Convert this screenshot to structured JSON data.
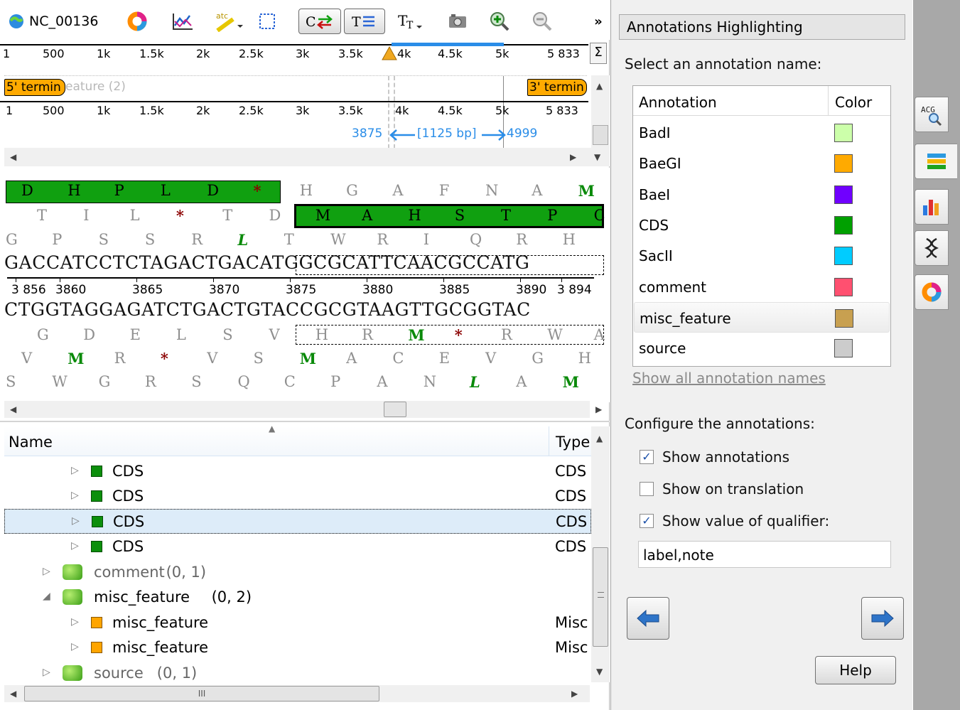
{
  "toolbar": {
    "sequence_name": "NC_00136",
    "overflow": "»"
  },
  "overview_ruler": {
    "labels": [
      "1",
      "500",
      "1k",
      "1.5k",
      "2k",
      "2.5k",
      "3k",
      "3.5k",
      "4k",
      "4.5k",
      "5k",
      "5 833"
    ],
    "sigma": "Σ"
  },
  "feature_track": {
    "left_arrow": "5' termin",
    "middle_text": "eature (2)",
    "right_arrow": "3' termin"
  },
  "detail_ruler": {
    "labels": [
      "1",
      "500",
      "1k",
      "1.5k",
      "2k",
      "2.5k",
      "3k",
      "3.5k",
      "4k",
      "4.5k",
      "5k",
      "5 833"
    ],
    "selection_start": "3875",
    "selection_len": "[1125 bp]",
    "selection_end": "4999"
  },
  "sequence": {
    "frame1": [
      "D",
      "H",
      "P",
      "L",
      "D",
      "*",
      "H",
      "G",
      "A",
      "F",
      "N",
      "A",
      "M"
    ],
    "frame2": [
      "T",
      "I",
      "L",
      "*",
      "T",
      "D",
      "M",
      "A",
      "H",
      "S",
      "T",
      "P",
      "C"
    ],
    "frame3": [
      "G",
      "P",
      "S",
      "S",
      "R",
      "L",
      "T",
      "W",
      "R",
      "I",
      "Q",
      "R",
      "H"
    ],
    "dna_top": "GACCATCCTCTAGACTGACATGGCGCATTCAACGCCATG",
    "positions": [
      "3 856",
      "3860",
      "3865",
      "3870",
      "3875",
      "3880",
      "3885",
      "3890",
      "3 894"
    ],
    "dna_bottom": "CTGGTAGGAGATCTGACTGTACCGCGTAAGTTGCGGTAC",
    "rframe1": [
      "G",
      "D",
      "E",
      "L",
      "S",
      "V",
      "H",
      "R",
      "M",
      "*",
      "R",
      "W",
      "A"
    ],
    "rframe2": [
      "V",
      "M",
      "R",
      "*",
      "V",
      "S",
      "M",
      "A",
      "C",
      "E",
      "V",
      "G",
      "H"
    ],
    "rframe3": [
      "S",
      "W",
      "G",
      "R",
      "S",
      "Q",
      "C",
      "P",
      "A",
      "N",
      "L",
      "A",
      "M"
    ]
  },
  "tree": {
    "header_name": "Name",
    "header_type": "Type",
    "rows": [
      {
        "label": "CDS",
        "type": "CDS"
      },
      {
        "label": "CDS",
        "type": "CDS"
      },
      {
        "label": "CDS",
        "type": "CDS"
      },
      {
        "label": "CDS",
        "type": "CDS"
      },
      {
        "label": "comment",
        "count": "(0, 1)"
      },
      {
        "label": "misc_feature",
        "count": "(0, 2)"
      },
      {
        "label": "misc_feature",
        "type": "Misc"
      },
      {
        "label": "misc_feature",
        "type": "Misc"
      },
      {
        "label": "source",
        "count": "(0, 1)"
      }
    ],
    "hscroll_grip": "III"
  },
  "panel": {
    "title": "Annotations Highlighting",
    "select_label": "Select an annotation name:",
    "col_annotation": "Annotation",
    "col_color": "Color",
    "annotations": [
      {
        "name": "BadI",
        "color": "#ccffaa"
      },
      {
        "name": "BaeGI",
        "color": "#ffaa00"
      },
      {
        "name": "BaeI",
        "color": "#7000ff"
      },
      {
        "name": "CDS",
        "color": "#00a000"
      },
      {
        "name": "SacII",
        "color": "#00ccff"
      },
      {
        "name": "comment",
        "color": "#ff5070"
      },
      {
        "name": "misc_feature",
        "color": "#c8a050"
      },
      {
        "name": "source",
        "color": "#cccccc"
      }
    ],
    "show_all_link": "Show all annotation names",
    "configure_label": "Configure the annotations:",
    "cb_show_annotations": "Show annotations",
    "cb_show_on_translation": "Show on translation",
    "cb_show_qualifier": "Show value of qualifier:",
    "qualifier_value": "label,note",
    "help_button": "Help"
  },
  "tabs": {
    "seq_view_tab": "ACG"
  }
}
